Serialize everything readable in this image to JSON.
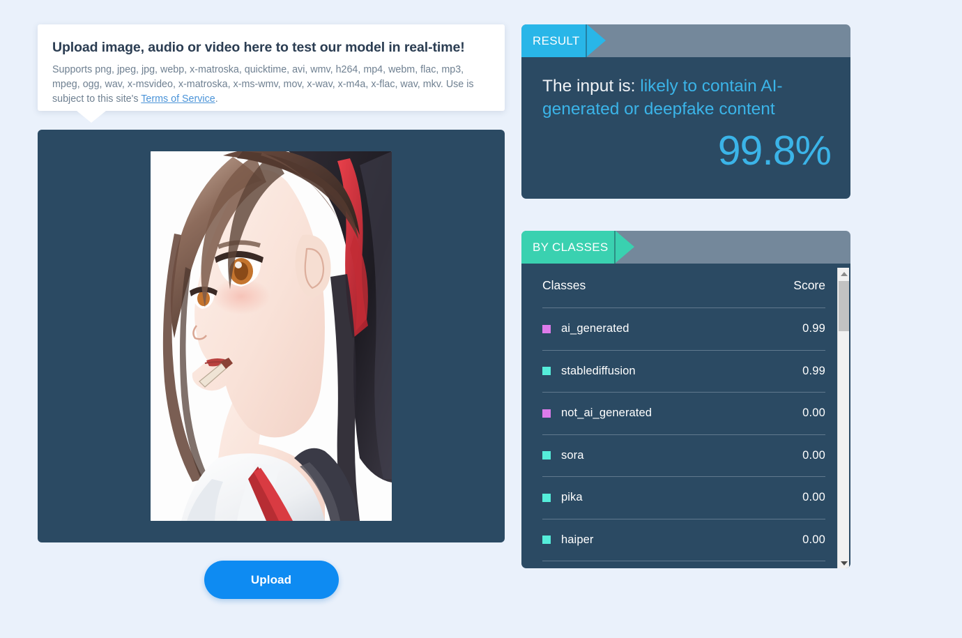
{
  "upload_info": {
    "title": "Upload image, audio or video here to test our model in real-time!",
    "supports_text": "Supports png, jpeg, jpg, webp, x-matroska, quicktime, avi, wmv, h264, mp4, webm, flac, mp3, mpeg, ogg, wav, x-msvideo, x-matroska, x-ms-wmv, mov, x-wav, x-m4a, x-flac, wav, mkv. Use is subject to this site's ",
    "terms_link_label": "Terms of Service",
    "supports_text_end": "."
  },
  "preview": {
    "alt": "anime-style portrait of a girl in profile with red hair ribbon"
  },
  "upload_button": {
    "label": "Upload"
  },
  "result": {
    "tab_label": "RESULT",
    "prefix": "The input is: ",
    "verdict": "likely to contain AI-generated or deepfake content",
    "percent": "99.8%"
  },
  "by_classes": {
    "tab_label": "BY CLASSES",
    "col_classes": "Classes",
    "col_score": "Score",
    "rows": [
      {
        "name": "ai_generated",
        "score": "0.99",
        "color": "#dd7bea"
      },
      {
        "name": "stablediffusion",
        "score": "0.99",
        "color": "#55edda"
      },
      {
        "name": "not_ai_generated",
        "score": "0.00",
        "color": "#dd7bea"
      },
      {
        "name": "sora",
        "score": "0.00",
        "color": "#55edda"
      },
      {
        "name": "pika",
        "score": "0.00",
        "color": "#55edda"
      },
      {
        "name": "haiper",
        "score": "0.00",
        "color": "#55edda"
      }
    ]
  },
  "colors": {
    "page_bg": "#eaf1fb",
    "panel_dark": "#2b4a63",
    "panel_head": "#74889b",
    "tab_result": "#29b6e8",
    "tab_classes": "#3ad1b0",
    "accent_blue": "#3bb4e8",
    "upload_blue": "#0e8bf2",
    "link_blue": "#4a93d8"
  }
}
